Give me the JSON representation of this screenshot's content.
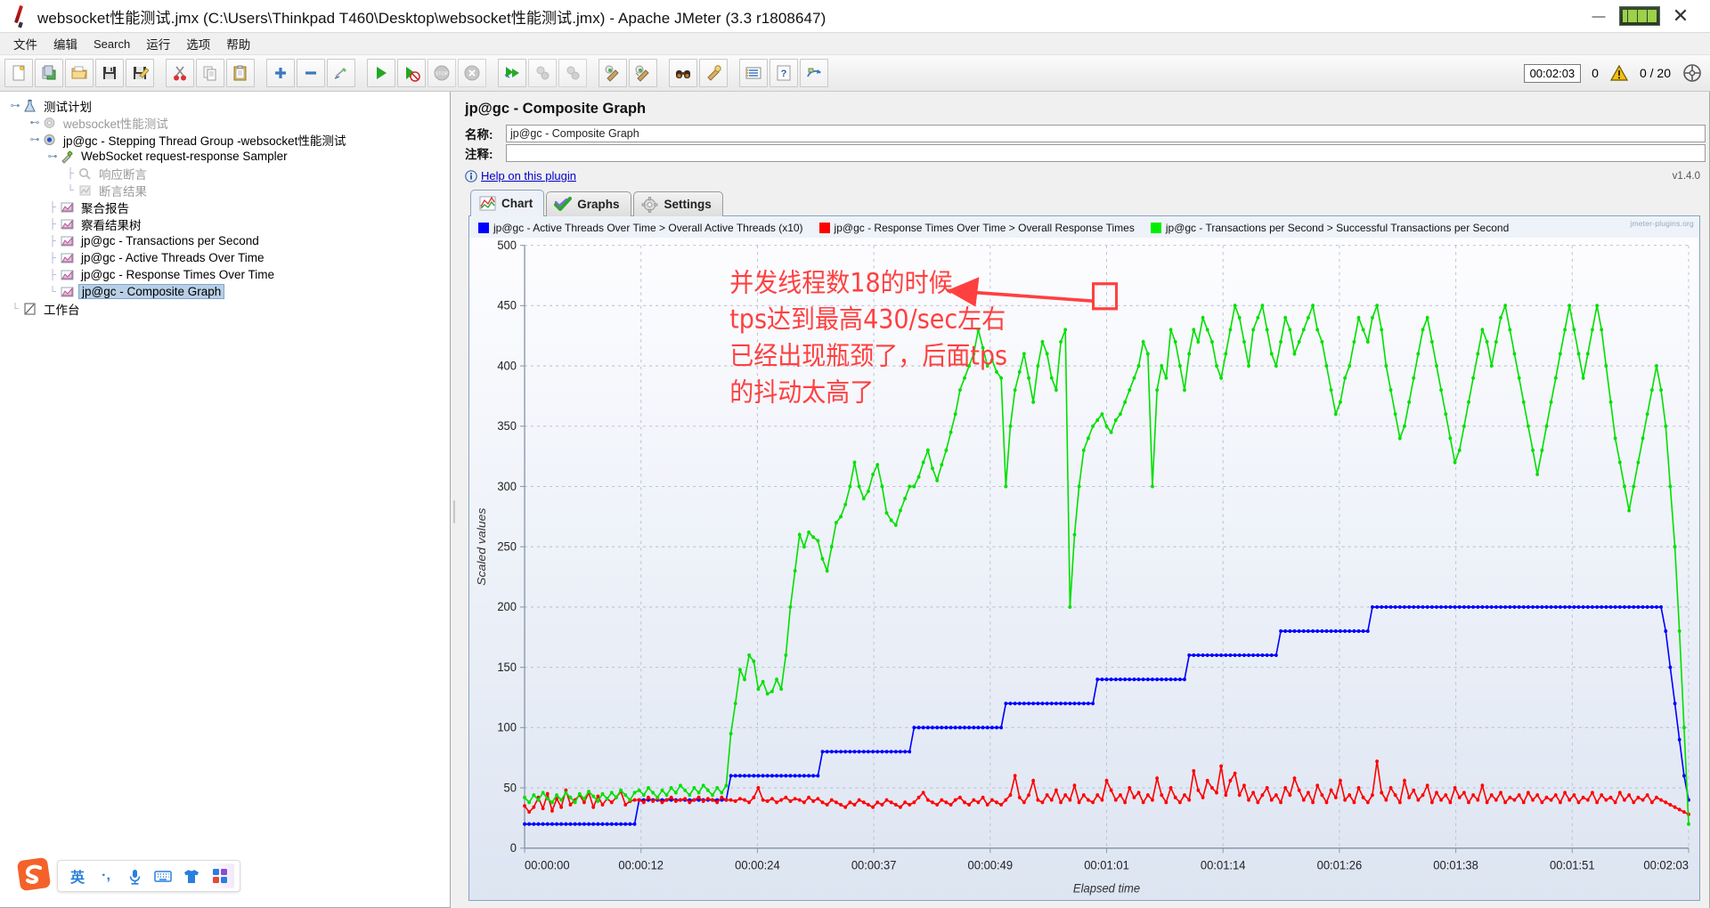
{
  "window": {
    "title": "websocket性能测试.jmx (C:\\Users\\Thinkpad T460\\Desktop\\websocket性能测试.jmx) - Apache JMeter (3.3 r1808647)",
    "app_icon": "jmeter-feather-icon",
    "minimize": "—",
    "restore": "restore-icon",
    "close": "✕"
  },
  "menu": {
    "items": [
      {
        "label": "文件",
        "name": "menu-file"
      },
      {
        "label": "编辑",
        "name": "menu-edit"
      },
      {
        "label": "Search",
        "name": "menu-search"
      },
      {
        "label": "运行",
        "name": "menu-run"
      },
      {
        "label": "选项",
        "name": "menu-options"
      },
      {
        "label": "帮助",
        "name": "menu-help"
      }
    ]
  },
  "toolbar": {
    "buttons": [
      {
        "name": "new-button",
        "icon": "new-document-icon"
      },
      {
        "name": "templates-button",
        "icon": "templates-icon"
      },
      {
        "name": "open-button",
        "icon": "open-folder-icon"
      },
      {
        "name": "save-button",
        "icon": "save-disk-icon"
      },
      {
        "name": "save-as-button",
        "icon": "save-as-icon"
      },
      {
        "name": "cut-button",
        "icon": "scissors-icon"
      },
      {
        "name": "copy-button",
        "icon": "copy-icon"
      },
      {
        "name": "paste-button",
        "icon": "clipboard-icon"
      },
      {
        "name": "expand-all-button",
        "icon": "plus-icon"
      },
      {
        "name": "collapse-all-button",
        "icon": "minus-icon"
      },
      {
        "name": "toggle-button",
        "icon": "toggle-pencil-icon"
      },
      {
        "name": "start-button",
        "icon": "play-green-icon"
      },
      {
        "name": "start-no-pauses-button",
        "icon": "play-no-pause-icon"
      },
      {
        "name": "stop-button",
        "icon": "stop-sign-icon"
      },
      {
        "name": "shutdown-button",
        "icon": "shutdown-x-icon"
      },
      {
        "name": "start-remote-button",
        "icon": "remote-start-icon"
      },
      {
        "name": "stop-remote-button",
        "icon": "remote-stop-icon"
      },
      {
        "name": "shutdown-remote-button",
        "icon": "remote-shutdown-icon"
      },
      {
        "name": "clear-button",
        "icon": "broom-green-icon"
      },
      {
        "name": "clear-all-button",
        "icon": "broom-all-icon"
      },
      {
        "name": "search-button",
        "icon": "binoculars-icon"
      },
      {
        "name": "reset-search-button",
        "icon": "reset-search-icon"
      },
      {
        "name": "function-helper-button",
        "icon": "function-list-icon"
      },
      {
        "name": "help-button",
        "icon": "help-question-icon"
      },
      {
        "name": "undo-redo-button",
        "icon": "undo-icon"
      }
    ],
    "status": {
      "elapsed": "00:02:03",
      "error_count": "0",
      "warning_icon": "warning-triangle-icon",
      "threads": "0 / 20",
      "connection_icon": "remote-connection-icon"
    }
  },
  "tree": {
    "items": [
      {
        "label": "测试计划",
        "name": "tree-item-test-plan",
        "depth": 0,
        "icon": "test-plan-icon",
        "handle": "expanded",
        "state": "normal"
      },
      {
        "label": "websocket性能测试",
        "name": "tree-item-websocket-config",
        "depth": 1,
        "icon": "gear-gray-icon",
        "handle": "collapsed",
        "state": "disabled"
      },
      {
        "label": "jp@gc - Stepping Thread Group -websocket性能测试",
        "name": "tree-item-stepping-thread-group",
        "depth": 1,
        "icon": "thread-group-icon",
        "handle": "expanded",
        "state": "normal"
      },
      {
        "label": "WebSocket request-response Sampler",
        "name": "tree-item-websocket-sampler",
        "depth": 2,
        "icon": "sampler-pipette-icon",
        "handle": "expanded",
        "state": "normal"
      },
      {
        "label": "响应断言",
        "name": "tree-item-response-assertion",
        "depth": 3,
        "icon": "assertion-icon",
        "handle": "none",
        "state": "disabled"
      },
      {
        "label": "断言结果",
        "name": "tree-item-assertion-results",
        "depth": 3,
        "icon": "assertion-result-icon",
        "handle": "none",
        "state": "disabled"
      },
      {
        "label": "聚合报告",
        "name": "tree-item-aggregate-report",
        "depth": 2,
        "icon": "listener-chart-icon",
        "handle": "none",
        "state": "normal"
      },
      {
        "label": "察看结果树",
        "name": "tree-item-view-results-tree",
        "depth": 2,
        "icon": "listener-chart-icon",
        "handle": "none",
        "state": "normal"
      },
      {
        "label": "jp@gc - Transactions per Second",
        "name": "tree-item-transactions-per-second",
        "depth": 2,
        "icon": "listener-chart-icon",
        "handle": "none",
        "state": "normal"
      },
      {
        "label": "jp@gc - Active Threads Over Time",
        "name": "tree-item-active-threads-over-time",
        "depth": 2,
        "icon": "listener-chart-icon",
        "handle": "none",
        "state": "normal"
      },
      {
        "label": "jp@gc - Response Times Over Time",
        "name": "tree-item-response-times-over-time",
        "depth": 2,
        "icon": "listener-chart-icon",
        "handle": "none",
        "state": "normal"
      },
      {
        "label": "jp@gc - Composite Graph",
        "name": "tree-item-composite-graph",
        "depth": 2,
        "icon": "listener-chart-icon",
        "handle": "none",
        "state": "selected"
      },
      {
        "label": "工作台",
        "name": "tree-item-workbench",
        "depth": 0,
        "icon": "workbench-icon",
        "handle": "none",
        "state": "normal"
      }
    ]
  },
  "panel": {
    "title": "jp@gc - Composite Graph",
    "name_label": "名称:",
    "name_value": "jp@gc - Composite Graph",
    "comment_label": "注释:",
    "comment_value": "",
    "help_link": "Help on this plugin",
    "version": "v1.4.0",
    "tabs": [
      {
        "label": "Chart",
        "name": "tab-chart",
        "icon": "chart-lines-icon",
        "active": true
      },
      {
        "label": "Graphs",
        "name": "tab-graphs",
        "icon": "green-check-icon",
        "active": false
      },
      {
        "label": "Settings",
        "name": "tab-settings",
        "icon": "gear-icon",
        "active": false
      }
    ],
    "watermark": "jmeter-plugins.org"
  },
  "annotation": {
    "lines": [
      "并发线程数18的时候",
      "tps达到最高430/sec左右",
      "已经出现瓶颈了，后面tps",
      "的抖动太高了"
    ],
    "color": "#ff4040",
    "arrow": "arrow-pointing-right",
    "highlight_box": "red-highlight-rectangle"
  },
  "ime": {
    "logo": "sogou-logo-icon",
    "items": [
      {
        "label": "英",
        "name": "ime-language-toggle",
        "icon": "english-mode-icon"
      },
      {
        "label": "·,",
        "name": "ime-punctuation-toggle",
        "icon": "punctuation-icon"
      },
      {
        "label": "",
        "name": "ime-voice-input",
        "icon": "microphone-icon"
      },
      {
        "label": "",
        "name": "ime-soft-keyboard",
        "icon": "keyboard-icon"
      },
      {
        "label": "",
        "name": "ime-skin",
        "icon": "tshirt-skin-icon"
      },
      {
        "label": "",
        "name": "ime-toolbox",
        "icon": "toolbox-grid-icon"
      }
    ]
  },
  "chart_data": {
    "type": "line",
    "title": "jp@gc - Composite Graph",
    "xlabel": "Elapsed time",
    "ylabel": "Scaled values",
    "ylim": [
      0,
      500
    ],
    "yticks": [
      0,
      50,
      100,
      150,
      200,
      250,
      300,
      350,
      400,
      450,
      500
    ],
    "xticks": [
      "00:00:00",
      "00:00:12",
      "00:00:24",
      "00:00:37",
      "00:00:49",
      "00:01:01",
      "00:01:14",
      "00:01:26",
      "00:01:38",
      "00:01:51",
      "00:02:03"
    ],
    "grid": true,
    "legend_position": "top",
    "series": [
      {
        "name": "jp@gc - Active Threads Over Time > Overall Active Threads (x10)",
        "color": "#0000ff",
        "values": [
          20,
          20,
          20,
          20,
          20,
          20,
          20,
          20,
          20,
          20,
          20,
          20,
          20,
          20,
          20,
          20,
          20,
          20,
          20,
          20,
          20,
          20,
          20,
          20,
          20,
          40,
          40,
          40,
          40,
          40,
          40,
          40,
          40,
          40,
          40,
          40,
          40,
          40,
          40,
          40,
          40,
          40,
          40,
          40,
          40,
          60,
          60,
          60,
          60,
          60,
          60,
          60,
          60,
          60,
          60,
          60,
          60,
          60,
          60,
          60,
          60,
          60,
          60,
          60,
          60,
          80,
          80,
          80,
          80,
          80,
          80,
          80,
          80,
          80,
          80,
          80,
          80,
          80,
          80,
          80,
          80,
          80,
          80,
          80,
          80,
          100,
          100,
          100,
          100,
          100,
          100,
          100,
          100,
          100,
          100,
          100,
          100,
          100,
          100,
          100,
          100,
          100,
          100,
          100,
          100,
          120,
          120,
          120,
          120,
          120,
          120,
          120,
          120,
          120,
          120,
          120,
          120,
          120,
          120,
          120,
          120,
          120,
          120,
          120,
          120,
          140,
          140,
          140,
          140,
          140,
          140,
          140,
          140,
          140,
          140,
          140,
          140,
          140,
          140,
          140,
          140,
          140,
          140,
          140,
          140,
          160,
          160,
          160,
          160,
          160,
          160,
          160,
          160,
          160,
          160,
          160,
          160,
          160,
          160,
          160,
          160,
          160,
          160,
          160,
          160,
          180,
          180,
          180,
          180,
          180,
          180,
          180,
          180,
          180,
          180,
          180,
          180,
          180,
          180,
          180,
          180,
          180,
          180,
          180,
          180,
          200,
          200,
          200,
          200,
          200,
          200,
          200,
          200,
          200,
          200,
          200,
          200,
          200,
          200,
          200,
          200,
          200,
          200,
          200,
          200,
          200,
          200,
          200,
          200,
          200,
          200,
          200,
          200,
          200,
          200,
          200,
          200,
          200,
          200,
          200,
          200,
          200,
          200,
          200,
          200,
          200,
          200,
          200,
          200,
          200,
          200,
          200,
          200,
          200,
          200,
          200,
          200,
          200,
          200,
          200,
          200,
          200,
          200,
          200,
          200,
          200,
          200,
          200,
          200,
          180,
          150,
          120,
          90,
          60,
          40
        ]
      },
      {
        "name": "jp@gc - Response Times Over Time > Overall Response Times",
        "color": "#ff0000",
        "values": [
          35,
          30,
          34,
          42,
          33,
          45,
          31,
          41,
          34,
          48,
          36,
          40,
          44,
          38,
          46,
          34,
          43,
          36,
          41,
          38,
          42,
          47,
          36,
          39,
          40,
          40,
          38,
          42,
          39,
          41,
          38,
          40,
          42,
          39,
          40,
          41,
          38,
          40,
          42,
          39,
          41,
          40,
          38,
          42,
          40,
          40,
          39,
          41,
          40,
          38,
          42,
          50,
          40,
          39,
          41,
          38,
          40,
          42,
          39,
          41,
          40,
          38,
          42,
          39,
          41,
          38,
          36,
          40,
          38,
          36,
          34,
          38,
          36,
          40,
          38,
          36,
          34,
          38,
          36,
          40,
          38,
          36,
          34,
          38,
          36,
          38,
          42,
          46,
          40,
          38,
          36,
          40,
          38,
          36,
          40,
          42,
          38,
          36,
          40,
          38,
          42,
          36,
          40,
          38,
          36,
          40,
          44,
          60,
          42,
          38,
          44,
          56,
          40,
          38,
          44,
          40,
          48,
          38,
          44,
          40,
          52,
          38,
          44,
          40,
          38,
          44,
          40,
          56,
          48,
          40,
          44,
          38,
          50,
          42,
          46,
          38,
          44,
          40,
          58,
          44,
          38,
          50,
          42,
          38,
          44,
          40,
          64,
          48,
          42,
          56,
          50,
          46,
          68,
          44,
          56,
          62,
          44,
          52,
          40,
          46,
          38,
          44,
          50,
          40,
          44,
          38,
          50,
          44,
          58,
          48,
          40,
          46,
          38,
          52,
          44,
          38,
          48,
          42,
          56,
          40,
          44,
          38,
          50,
          42,
          38,
          44,
          72,
          46,
          40,
          50,
          44,
          38,
          56,
          42,
          48,
          40,
          44,
          52,
          38,
          46,
          40,
          44,
          38,
          50,
          42,
          46,
          38,
          44,
          40,
          52,
          38,
          44,
          40,
          46,
          38,
          42,
          40,
          44,
          38,
          46,
          40,
          44,
          38,
          42,
          40,
          44,
          38,
          46,
          40,
          44,
          38,
          42,
          40,
          46,
          38,
          44,
          40,
          42,
          38,
          46,
          40,
          44,
          38,
          42,
          40,
          44,
          38,
          42,
          40,
          38,
          36,
          34,
          32,
          30,
          28
        ]
      },
      {
        "name": "jp@gc - Transactions per Second > Successful Transactions per Second",
        "color": "#00e000",
        "values": [
          42,
          38,
          44,
          40,
          46,
          41,
          38,
          44,
          40,
          46,
          42,
          38,
          45,
          41,
          47,
          43,
          39,
          45,
          41,
          46,
          42,
          48,
          44,
          40,
          46,
          48,
          44,
          50,
          46,
          42,
          48,
          44,
          50,
          46,
          52,
          48,
          44,
          50,
          46,
          52,
          48,
          44,
          50,
          46,
          52,
          95,
          120,
          148,
          140,
          160,
          155,
          132,
          138,
          128,
          130,
          140,
          132,
          160,
          200,
          230,
          260,
          250,
          262,
          258,
          255,
          240,
          230,
          250,
          270,
          275,
          285,
          300,
          320,
          300,
          290,
          296,
          310,
          318,
          300,
          278,
          272,
          268,
          280,
          290,
          300,
          300,
          308,
          320,
          330,
          315,
          305,
          318,
          330,
          345,
          360,
          380,
          390,
          400,
          410,
          430,
          415,
          400,
          405,
          395,
          390,
          300,
          350,
          380,
          395,
          410,
          390,
          370,
          400,
          420,
          410,
          390,
          380,
          420,
          430,
          200,
          260,
          300,
          330,
          340,
          350,
          355,
          360,
          350,
          345,
          355,
          360,
          370,
          380,
          390,
          400,
          420,
          410,
          300,
          380,
          400,
          390,
          430,
          420,
          400,
          380,
          410,
          430,
          420,
          440,
          430,
          420,
          400,
          390,
          410,
          430,
          450,
          440,
          420,
          400,
          430,
          440,
          450,
          430,
          410,
          400,
          420,
          440,
          430,
          410,
          420,
          430,
          440,
          450,
          430,
          420,
          400,
          380,
          360,
          370,
          390,
          400,
          420,
          440,
          430,
          420,
          440,
          450,
          430,
          400,
          380,
          360,
          340,
          350,
          370,
          390,
          410,
          430,
          440,
          420,
          400,
          380,
          360,
          340,
          320,
          330,
          350,
          370,
          390,
          410,
          430,
          420,
          400,
          420,
          440,
          450,
          430,
          410,
          390,
          370,
          350,
          330,
          310,
          330,
          350,
          370,
          390,
          410,
          430,
          450,
          430,
          410,
          390,
          410,
          430,
          450,
          430,
          400,
          370,
          340,
          320,
          300,
          280,
          300,
          320,
          340,
          360,
          380,
          400,
          380,
          350,
          300,
          250,
          180,
          100,
          20
        ]
      }
    ]
  }
}
